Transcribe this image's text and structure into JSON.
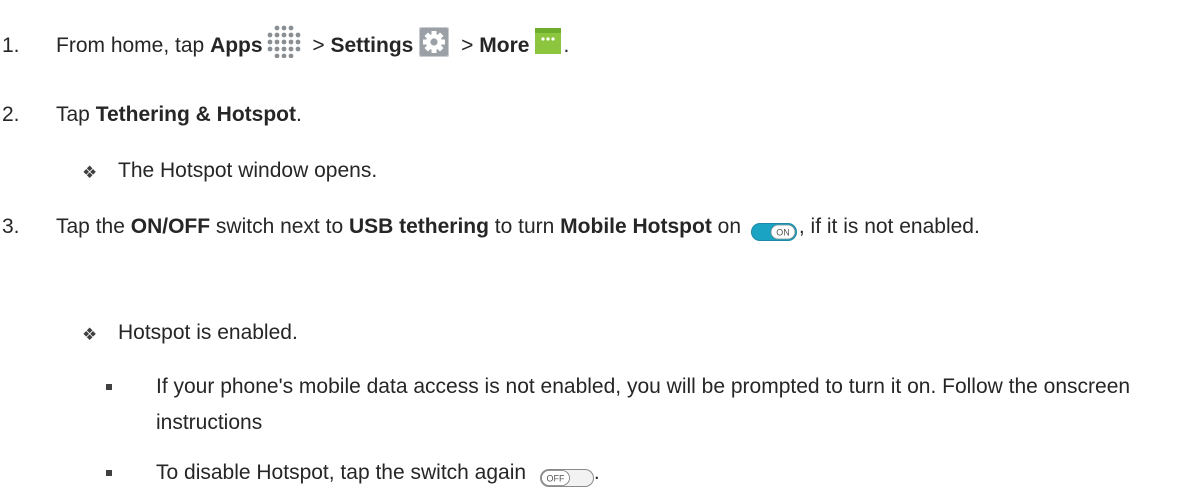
{
  "steps": [
    {
      "number": "1.",
      "parts": [
        "From home, tap ",
        "Apps",
        " > ",
        "Settings",
        " > ",
        "More",
        "."
      ]
    },
    {
      "number": "2.",
      "parts": [
        "Tap ",
        "Tethering & Hotspot",
        "."
      ],
      "result": "The Hotspot window opens."
    },
    {
      "number": "3.",
      "parts": [
        "Tap the ",
        "ON/OFF",
        " switch next to ",
        "USB tethering",
        " to turn ",
        "Mobile Hotspot",
        " on ",
        ", if it is not enabled."
      ],
      "result": "Hotspot is enabled.",
      "notes": [
        "If your phone's mobile data access is not enabled, you will be prompted to turn it on. Follow the onscreen instructions",
        "To disable Hotspot, tap the switch again ",
        "."
      ]
    }
  ],
  "icons": {
    "switch_on_label": "ON",
    "switch_off_label": "OFF",
    "result_bullet": "❖",
    "colors": {
      "switch_on": "#1aa3c2",
      "more_icon": "#8cc63f",
      "settings_icon": "#8a8f93"
    }
  }
}
